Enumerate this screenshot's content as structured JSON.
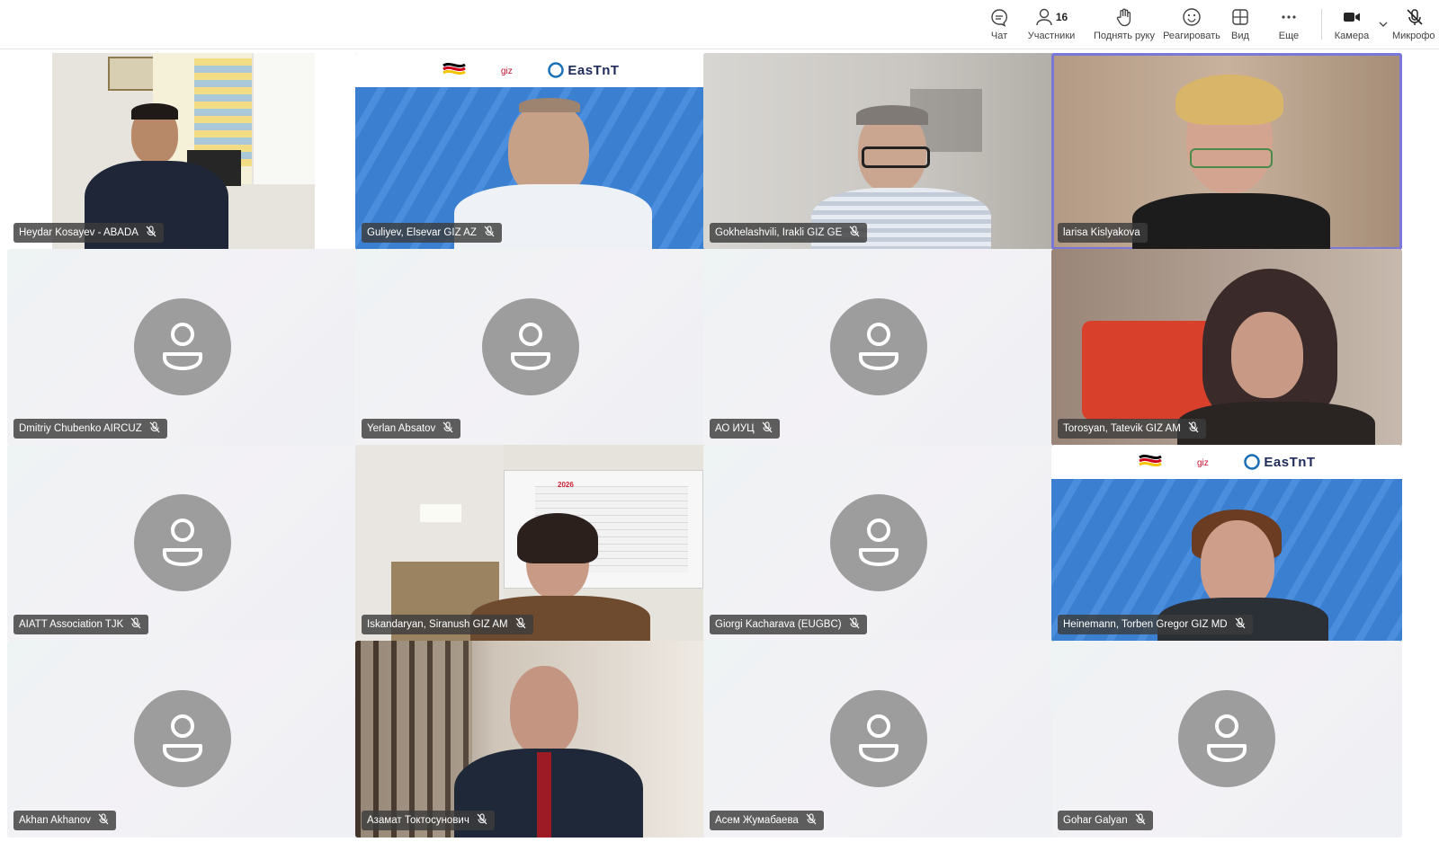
{
  "toolbar": {
    "chat_label": "Чат",
    "participants_label": "Участники",
    "participants_count": "16",
    "raise_hand_label": "Поднять руку",
    "react_label": "Реагировать",
    "view_label": "Вид",
    "more_label": "Еще",
    "camera_label": "Камера",
    "mic_label": "Микрофо"
  },
  "participants": [
    {
      "name": "Heydar Kosayev - ABADA",
      "video": true
    },
    {
      "name": "Guliyev, Elsevar GIZ AZ",
      "video": true
    },
    {
      "name": "Gokhelashvili, Irakli GIZ GE",
      "video": true
    },
    {
      "name": "larisa Kislyakova",
      "video": true,
      "active_speaker": true
    },
    {
      "name": "Dmitriy Chubenko AIRCUZ",
      "video": false
    },
    {
      "name": "Yerlan Absatov",
      "video": false
    },
    {
      "name": "АО ИУЦ",
      "video": false
    },
    {
      "name": "Torosyan, Tatevik GIZ AM",
      "video": true
    },
    {
      "name": "AIATT Association TJK",
      "video": false
    },
    {
      "name": "Iskandaryan, Siranush GIZ AM",
      "video": true
    },
    {
      "name": "Giorgi Kacharava (EUGBC)",
      "video": false
    },
    {
      "name": "Heinemann, Torben Gregor GIZ MD",
      "video": true
    },
    {
      "name": "Akhan Akhanov",
      "video": false
    },
    {
      "name": "Азамат Токтосунович",
      "video": true
    },
    {
      "name": "Асем Жумабаева",
      "video": false
    },
    {
      "name": "Gohar Galyan",
      "video": false
    }
  ],
  "branding": {
    "eastnt": "EasTnT",
    "calendar_year": "2026"
  },
  "colors": {
    "active_border": "#7a77d8",
    "avatar_gray": "#9d9d9d",
    "brand_blue": "#3b7fd1"
  }
}
